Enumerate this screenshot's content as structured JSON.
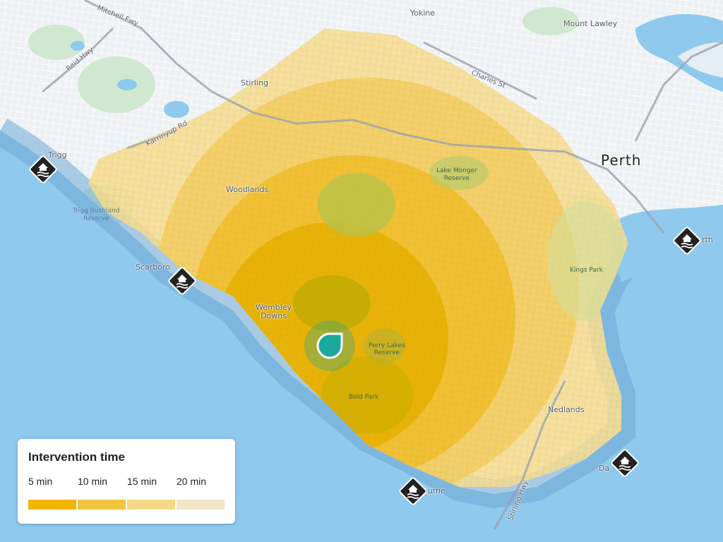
{
  "map": {
    "places": {
      "perth": "Perth",
      "yokine": "Yokine",
      "mount_lawley": "Mount Lawley",
      "stirling": "Stirling",
      "woodlands": "Woodlands",
      "trigg": "Trigg",
      "scarborough": "Scarboro",
      "wembley_downs": "Wembley\nDowns",
      "nedlands": "Nedlands",
      "cottesloe": "ourne",
      "dalkeith": "Da",
      "south_perth": "rth"
    },
    "parks": {
      "lake_monger": "Lake Monger\nReserve",
      "trigg_bushland": "Trigg Bushland\nReserve",
      "kings_park": "Kings Park",
      "perry_lakes": "Perry Lakes\nReserve",
      "bold_park": "Bold Park"
    },
    "roads": {
      "mitchell_fwy": "Mitchell Fwy",
      "reid_hwy": "Reid Hwy",
      "charles_st": "Charles St",
      "karrinyup_rd": "Karrinyup Rd",
      "stirling_hwy": "Stirling Hwy"
    },
    "markers": [
      {
        "name": "trigg-beach",
        "icon": "beach-flood-icon"
      },
      {
        "name": "scarborough-beach",
        "icon": "beach-flood-icon"
      },
      {
        "name": "cottesloe-beach",
        "icon": "beach-flood-icon"
      },
      {
        "name": "swan-river-south",
        "icon": "beach-flood-icon"
      },
      {
        "name": "swan-river-dalkeith",
        "icon": "beach-flood-icon"
      }
    ],
    "location_icon": "location-pin-icon"
  },
  "legend": {
    "title": "Intervention time",
    "items": [
      {
        "label": "5 min",
        "color": "#f1b400"
      },
      {
        "label": "10 min",
        "color": "#f3c53f"
      },
      {
        "label": "15 min",
        "color": "#f6d985"
      },
      {
        "label": "20 min",
        "color": "#f2e6c4"
      }
    ]
  },
  "colors": {
    "water": "#8fc9ee",
    "land": "#eef1f4",
    "park": "#cfe8cf",
    "zone_20": "#f6dd92",
    "zone_15": "#f2cb5b",
    "zone_10": "#f0bb23",
    "zone_5": "#eab200",
    "location": "#1ba89c"
  }
}
